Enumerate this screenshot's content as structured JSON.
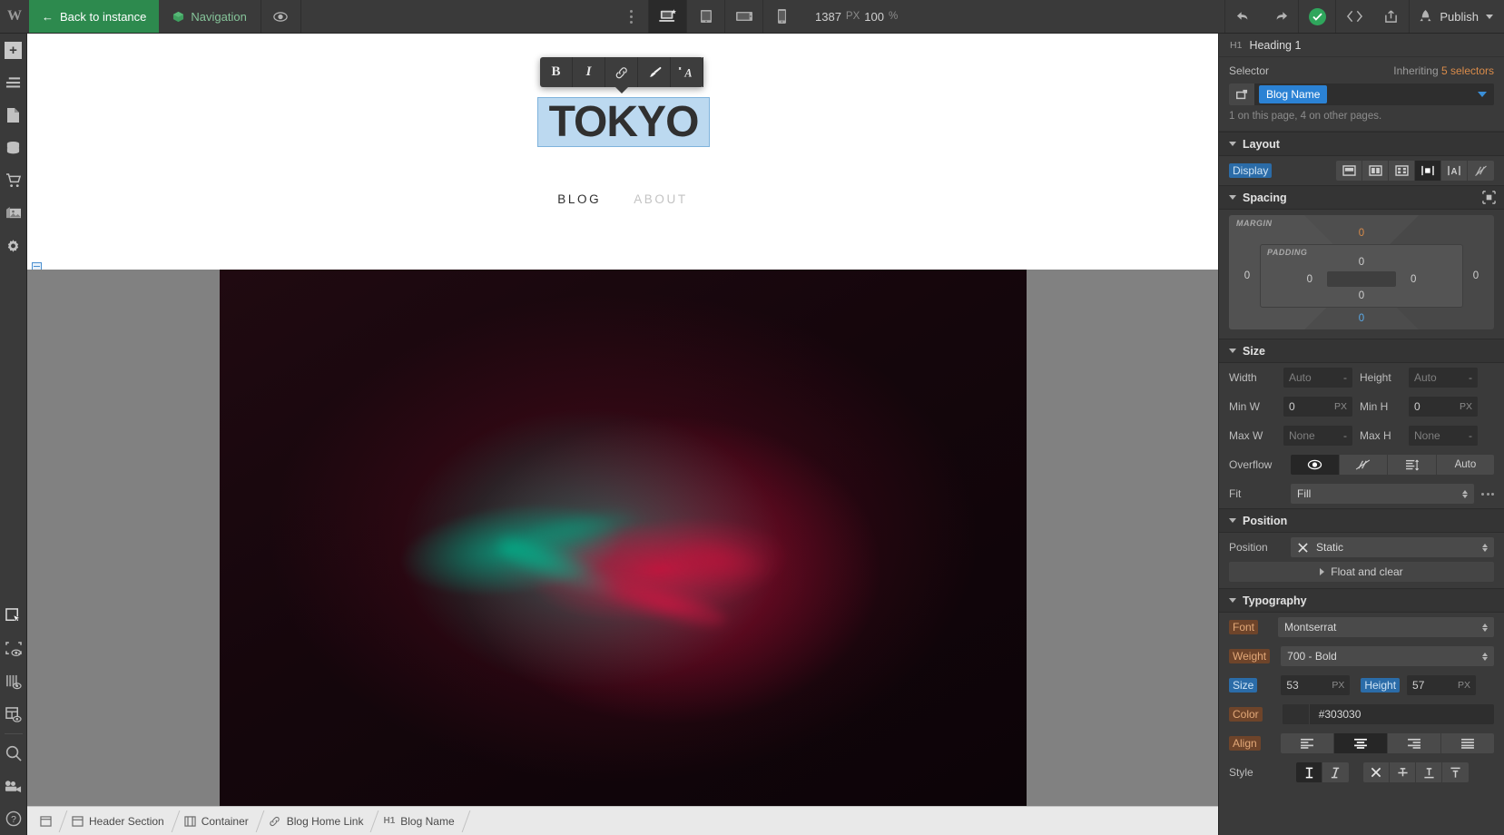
{
  "topbar": {
    "logo": "W",
    "back_label": "Back to instance",
    "nav_label": "Navigation",
    "preview_icon": "eye-icon",
    "more_icon": "more-vertical-icon",
    "breakpoints": [
      {
        "name": "desktop",
        "icon": "desktop-star-icon",
        "active": true
      },
      {
        "name": "tablet",
        "icon": "tablet-icon",
        "active": false
      },
      {
        "name": "mobile-landscape",
        "icon": "mobile-landscape-icon",
        "active": false
      },
      {
        "name": "mobile-portrait",
        "icon": "mobile-portrait-icon",
        "active": false
      }
    ],
    "canvas_width": "1387",
    "canvas_width_unit": "PX",
    "zoom_value": "100",
    "zoom_unit": "%",
    "undo_icon": "undo-arrow-icon",
    "redo_icon": "redo-arrow-icon",
    "status_icon": "checkmark-circle-icon",
    "code_icon": "code-brackets-icon",
    "export_icon": "share-export-icon",
    "rocket_icon": "rocket-icon",
    "publish_label": "Publish"
  },
  "left_rail": {
    "top_items": [
      {
        "name": "add-elements",
        "icon": "plus-icon"
      },
      {
        "name": "navigator",
        "icon": "navigator-icon"
      },
      {
        "name": "pages",
        "icon": "page-icon"
      },
      {
        "name": "cms-collections",
        "icon": "database-icon"
      },
      {
        "name": "ecommerce",
        "icon": "shopping-cart-icon"
      },
      {
        "name": "assets",
        "icon": "image-stack-icon"
      },
      {
        "name": "site-settings",
        "icon": "gear-icon"
      }
    ],
    "bottom_items": [
      {
        "name": "select-tool",
        "icon": "cursor-select-icon"
      },
      {
        "name": "element-preview",
        "icon": "marquee-eye-icon"
      },
      {
        "name": "grid-guides",
        "icon": "columns-eye-icon"
      },
      {
        "name": "layout-preview",
        "icon": "layout-eye-icon"
      },
      {
        "name": "search",
        "icon": "search-icon"
      },
      {
        "name": "video-tutorials",
        "icon": "video-camera-icon"
      },
      {
        "name": "help",
        "icon": "question-circle-icon"
      }
    ]
  },
  "rich_text_toolbar": {
    "buttons": [
      {
        "name": "bold",
        "label": "B",
        "icon": "bold-icon"
      },
      {
        "name": "italic",
        "label": "I",
        "icon": "italic-icon"
      },
      {
        "name": "link",
        "label": "",
        "icon": "link-chain-icon"
      },
      {
        "name": "format-paint",
        "label": "",
        "icon": "paintbrush-icon"
      },
      {
        "name": "clear-formatting",
        "label": "",
        "icon": "clear-format-icon"
      }
    ]
  },
  "canvas": {
    "blog_title": "TOKYO",
    "nav_links": [
      {
        "label": "BLOG",
        "active": true
      },
      {
        "label": "ABOUT",
        "active": false
      }
    ],
    "hero_alt": "hands-photo"
  },
  "breadcrumb": {
    "items": [
      {
        "label": "",
        "tag": "",
        "icon": "body-icon"
      },
      {
        "label": "Header Section",
        "tag": "",
        "icon": "section-icon"
      },
      {
        "label": "Container",
        "tag": "",
        "icon": "container-icon"
      },
      {
        "label": "Blog Home Link",
        "tag": "",
        "icon": "link-icon"
      },
      {
        "label": "Blog Name",
        "tag": "H1",
        "icon": ""
      }
    ]
  },
  "right_panel": {
    "tabs": [
      {
        "name": "style",
        "icon": "paintbrush-icon",
        "active": true
      },
      {
        "name": "settings",
        "icon": "gear-icon",
        "active": false
      },
      {
        "name": "interactions",
        "icon": "interactions-icon",
        "active": false
      },
      {
        "name": "effects",
        "icon": "lightning-icon",
        "active": false
      }
    ],
    "element": {
      "tag": "H1",
      "name": "Heading 1"
    },
    "selector": {
      "label": "Selector",
      "inheriting_prefix": "Inheriting ",
      "inheriting_count": "5 selectors",
      "chip": "Blog Name",
      "note": "1 on this page, 4 on other pages."
    },
    "layout": {
      "title": "Layout",
      "display_label": "Display",
      "options": [
        {
          "name": "display-block",
          "icon": "block-icon",
          "active": false
        },
        {
          "name": "display-flex",
          "icon": "flex-icon",
          "active": false
        },
        {
          "name": "display-grid",
          "icon": "grid-icon",
          "active": false
        },
        {
          "name": "display-inline-block",
          "icon": "inline-block-icon",
          "active": true
        },
        {
          "name": "display-inline",
          "icon": "inline-icon",
          "active": false
        },
        {
          "name": "display-none",
          "icon": "none-icon",
          "active": false
        }
      ]
    },
    "spacing": {
      "title": "Spacing",
      "margin_label": "MARGIN",
      "padding_label": "PADDING",
      "margin": {
        "top": "0",
        "right": "0",
        "bottom": "0",
        "left": "0"
      },
      "padding": {
        "top": "0",
        "right": "0",
        "bottom": "0",
        "left": "0"
      }
    },
    "size": {
      "title": "Size",
      "width_label": "Width",
      "width_value": "Auto",
      "height_label": "Height",
      "height_value": "Auto",
      "minw_label": "Min W",
      "minw_value": "0",
      "minw_unit": "PX",
      "minh_label": "Min H",
      "minh_value": "0",
      "minh_unit": "PX",
      "maxw_label": "Max W",
      "maxw_value": "None",
      "maxh_label": "Max H",
      "maxh_value": "None",
      "overflow_label": "Overflow",
      "overflow_options": [
        {
          "name": "overflow-visible",
          "icon": "eye-icon",
          "active": true
        },
        {
          "name": "overflow-hidden",
          "icon": "eye-off-icon",
          "active": false
        },
        {
          "name": "overflow-scroll",
          "icon": "scroll-icon",
          "active": false
        },
        {
          "name": "overflow-auto",
          "label": "Auto",
          "active": false
        }
      ],
      "fit_label": "Fit",
      "fit_value": "Fill"
    },
    "position": {
      "title": "Position",
      "position_label": "Position",
      "position_value": "Static",
      "float_label": "Float and clear"
    },
    "typography": {
      "title": "Typography",
      "font_label": "Font",
      "font_value": "Montserrat",
      "weight_label": "Weight",
      "weight_value": "700 - Bold",
      "size_label": "Size",
      "size_value": "53",
      "size_unit": "PX",
      "height_label": "Height",
      "height_value": "57",
      "height_unit": "PX",
      "color_label": "Color",
      "color_value": "#303030",
      "align_label": "Align",
      "align_options": [
        {
          "name": "align-left",
          "icon": "align-left-icon",
          "active": false
        },
        {
          "name": "align-center",
          "icon": "align-center-icon",
          "active": true
        },
        {
          "name": "align-right",
          "icon": "align-right-icon",
          "active": false
        },
        {
          "name": "align-justify",
          "icon": "align-justify-icon",
          "active": false
        }
      ],
      "style_label": "Style",
      "style_options": [
        {
          "name": "text-upright",
          "icon": "upright-text-icon",
          "active": true
        },
        {
          "name": "text-italic",
          "icon": "italic-icon",
          "active": false
        },
        {
          "name": "decoration-none",
          "icon": "x-icon",
          "active": false
        },
        {
          "name": "decoration-strikethrough",
          "icon": "strikethrough-icon",
          "active": false
        },
        {
          "name": "decoration-underline",
          "icon": "underline-icon",
          "active": false
        },
        {
          "name": "decoration-overline",
          "icon": "overline-icon",
          "active": false
        }
      ]
    }
  }
}
